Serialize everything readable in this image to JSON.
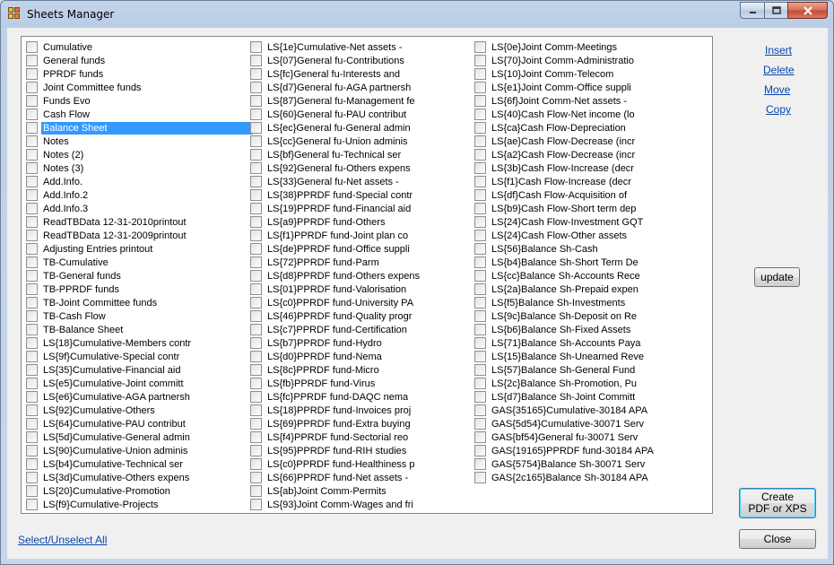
{
  "window": {
    "title": "Sheets Manager"
  },
  "sheets": {
    "columns": [
      [
        "Cumulative",
        "General funds",
        "PPRDF funds",
        "Joint Committee funds",
        "Funds Evo",
        "Cash Flow",
        "Balance Sheet",
        "Notes",
        "Notes (2)",
        "Notes (3)",
        "Add.Info.",
        "Add.Info.2",
        "Add.Info.3",
        "ReadTBData 12-31-2010printout",
        "ReadTBData 12-31-2009printout",
        "Adjusting Entries printout",
        "TB-Cumulative",
        "TB-General funds",
        "TB-PPRDF funds",
        "TB-Joint Committee funds",
        "TB-Cash Flow",
        "TB-Balance Sheet",
        "LS{18}Cumulative-Members contr",
        "LS{9f}Cumulative-Special contr",
        "LS{35}Cumulative-Financial aid",
        "LS{e5}Cumulative-Joint committ",
        "LS{e6}Cumulative-AGA partnersh",
        "LS{92}Cumulative-Others",
        "LS{64}Cumulative-PAU contribut",
        "LS{5d}Cumulative-General admin",
        "LS{90}Cumulative-Union adminis",
        "LS{b4}Cumulative-Technical ser",
        "LS{3d}Cumulative-Others expens",
        "LS{20}Cumulative-Promotion",
        "LS{f9}Cumulative-Projects"
      ],
      [
        "LS{1e}Cumulative-Net assets -",
        "LS{07}General fu-Contributions",
        "LS{fc}General fu-Interests and",
        "LS{d7}General fu-AGA partnersh",
        "LS{87}General fu-Management fe",
        "LS{60}General fu-PAU contribut",
        "LS{ec}General fu-General admin",
        "LS{cc}General fu-Union adminis",
        "LS{bf}General fu-Technical ser",
        "LS{92}General fu-Others expens",
        "LS{33}General fu-Net assets -",
        "LS{38}PPRDF fund-Special contr",
        "LS{19}PPRDF fund-Financial aid",
        "LS{a9}PPRDF fund-Others",
        "LS{f1}PPRDF fund-Joint plan co",
        "LS{de}PPRDF fund-Office suppli",
        "LS{72}PPRDF fund-Parm",
        "LS{d8}PPRDF fund-Others expens",
        "LS{01}PPRDF fund-Valorisation",
        "LS{c0}PPRDF fund-University PA",
        "LS{46}PPRDF fund-Quality progr",
        "LS{c7}PPRDF fund-Certification",
        "LS{b7}PPRDF fund-Hydro",
        "LS{d0}PPRDF fund-Nema",
        "LS{8c}PPRDF fund-Micro",
        "LS{fb}PPRDF fund-Virus",
        "LS{fc}PPRDF fund-DAQC nema",
        "LS{18}PPRDF fund-Invoices proj",
        "LS{69}PPRDF fund-Extra buying",
        "LS{f4}PPRDF fund-Sectorial reo",
        "LS{95}PPRDF fund-RIH studies",
        "LS{c0}PPRDF fund-Healthiness p",
        "LS{66}PPRDF fund-Net assets -",
        "LS{ab}Joint Comm-Permits",
        "LS{93}Joint Comm-Wages and fri"
      ],
      [
        "LS{0e}Joint Comm-Meetings",
        "LS{70}Joint Comm-Administratio",
        "LS{10}Joint Comm-Telecom",
        "LS{e1}Joint Comm-Office suppli",
        "LS{6f}Joint Comm-Net assets -",
        "LS{40}Cash Flow-Net income (lo",
        "LS{ca}Cash Flow-Depreciation",
        "LS{ae}Cash Flow-Decrease (incr",
        "LS{a2}Cash Flow-Decrease (incr",
        "LS{3b}Cash Flow-Increase (decr",
        "LS{f1}Cash Flow-Increase (decr",
        "LS{df}Cash Flow-Acquisition of",
        "LS{b9}Cash Flow-Short term dep",
        "LS{24}Cash Flow-Investment GQT",
        "LS{24}Cash Flow-Other assets",
        "LS{56}Balance Sh-Cash",
        "LS{b4}Balance Sh-Short Term De",
        "LS{cc}Balance Sh-Accounts Rece",
        "LS{2a}Balance Sh-Prepaid expen",
        "LS{f5}Balance Sh-Investments",
        "LS{9c}Balance Sh-Deposit on Re",
        "LS{b6}Balance Sh-Fixed Assets",
        "LS{71}Balance Sh-Accounts Paya",
        "LS{15}Balance Sh-Unearned Reve",
        "LS{57}Balance Sh-General Fund",
        "LS{2c}Balance Sh-Promotion, Pu",
        "LS{d7}Balance Sh-Joint Committ",
        "GAS{35165}Cumulative-30184 APA",
        "GAS{5d54}Cumulative-30071 Serv",
        "GAS{bf54}General fu-30071 Serv",
        "GAS{19165}PPRDF fund-30184 APA",
        "GAS{5754}Balance Sh-30071 Serv",
        "GAS{2c165}Balance Sh-30184 APA"
      ]
    ],
    "selected": "Balance Sheet"
  },
  "actions": {
    "insert": "Insert",
    "delete": "Delete",
    "move": "Move",
    "copy": "Copy",
    "update": "update",
    "create_pdf_line1": "Create",
    "create_pdf_line2": "PDF or XPS",
    "close": "Close",
    "select_all": "Select/Unselect All"
  },
  "icons": {
    "min": "minimize-icon",
    "max": "maximize-icon",
    "close": "close-icon"
  }
}
